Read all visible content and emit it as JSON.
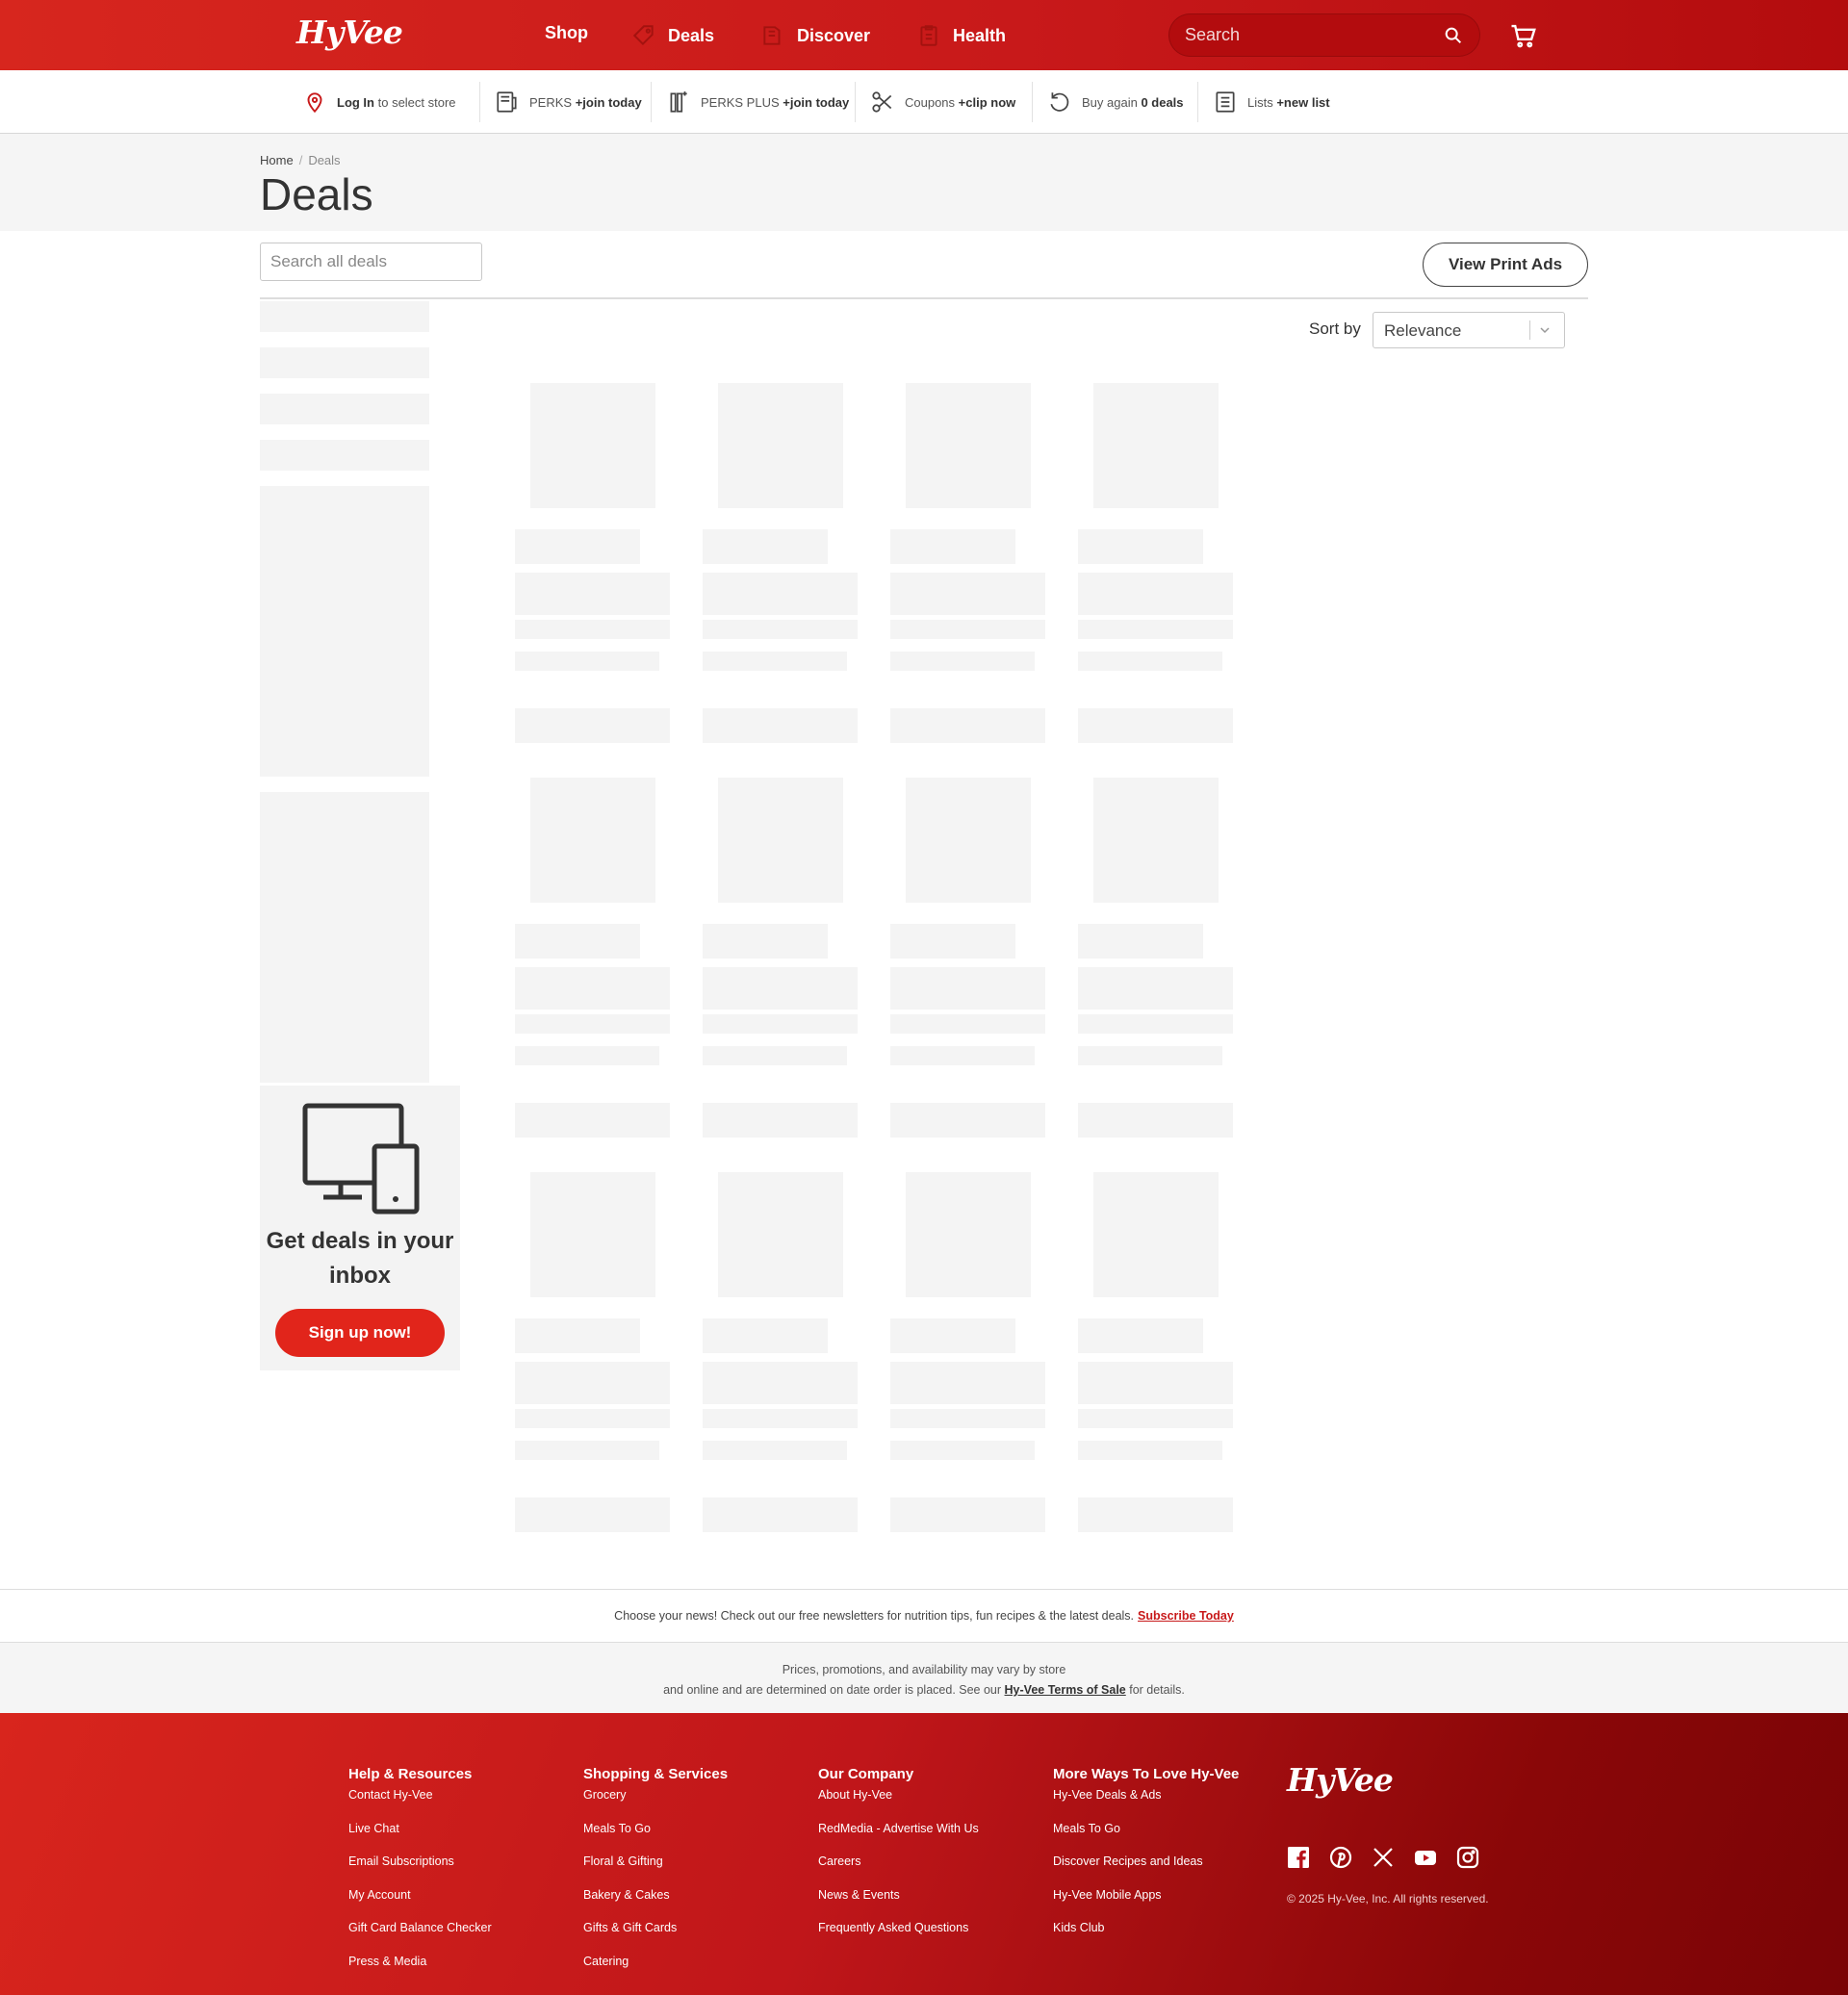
{
  "header": {
    "logo": "HyVee",
    "nav": [
      "Shop",
      "Deals",
      "Discover",
      "Health"
    ],
    "search_placeholder": "Search",
    "brand_color": "#d7261e"
  },
  "utility": {
    "login": {
      "bold": "Log In",
      "rest": " to select store"
    },
    "perks": {
      "text": "PERKS ",
      "bold": "+join today"
    },
    "perks_plus": {
      "text": "PERKS PLUS ",
      "bold": "+join today"
    },
    "coupons": {
      "text": "Coupons ",
      "bold": "+clip now"
    },
    "buy_again": {
      "text": "Buy again ",
      "bold": "0 deals"
    },
    "lists": {
      "text": "Lists ",
      "bold": "+new list"
    }
  },
  "breadcrumb": {
    "home": "Home",
    "sep": "/",
    "current": "Deals"
  },
  "page_title": "Deals",
  "toolbar": {
    "search_placeholder": "Search all deals",
    "print_ads": "View Print Ads",
    "sort_label": "Sort by",
    "sort_value": "Relevance"
  },
  "promo": {
    "title": "Get deals in your inbox",
    "button": "Sign up now!"
  },
  "newsletter": {
    "text": "Choose your news! Check out our free newsletters for nutrition tips, fun recipes & the latest deals.",
    "link": "Subscribe Today"
  },
  "disclaimer": {
    "line1": "Prices, promotions, and availability may vary by store",
    "line2_pre": "and online and are determined on date order is placed. See our ",
    "link": "Hy-Vee Terms of Sale",
    "line2_post": " for details."
  },
  "footer": {
    "columns": [
      {
        "title": "Help & Resources",
        "links": [
          "Contact Hy-Vee",
          "Live Chat",
          "Email Subscriptions",
          "My Account",
          "Gift Card Balance Checker",
          "Press & Media"
        ]
      },
      {
        "title": "Shopping & Services",
        "links": [
          "Grocery",
          "Meals To Go",
          "Floral & Gifting",
          "Bakery & Cakes",
          "Gifts & Gift Cards",
          "Catering"
        ]
      },
      {
        "title": "Our Company",
        "links": [
          "About Hy-Vee",
          "RedMedia - Advertise With Us",
          "Careers",
          "News & Events",
          "Frequently Asked Questions"
        ]
      },
      {
        "title": "More Ways To Love Hy-Vee",
        "links": [
          "Hy-Vee Deals & Ads",
          "Meals To Go",
          "Discover Recipes and Ideas",
          "Hy-Vee Mobile Apps",
          "Kids Club"
        ]
      }
    ],
    "logo": "HyVee",
    "socials": [
      "facebook-icon",
      "pinterest-icon",
      "x-icon",
      "youtube-icon",
      "instagram-icon"
    ],
    "copyright": "© 2025 Hy-Vee, Inc. All rights reserved."
  }
}
